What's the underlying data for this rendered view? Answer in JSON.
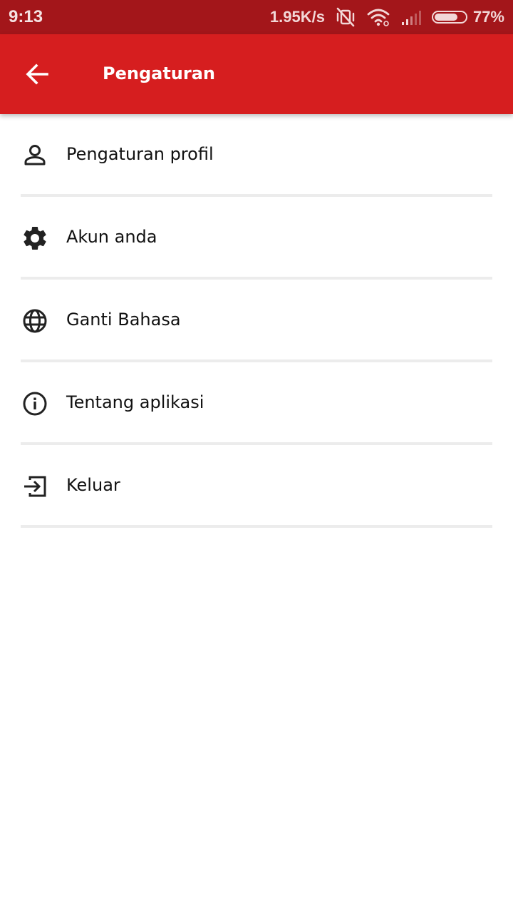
{
  "status_bar": {
    "time": "9:13",
    "net_speed": "1.95K/s",
    "battery_percent": "77%",
    "battery_level": 0.77,
    "icons": [
      "mute-vibrate-off-icon",
      "wifi-icon",
      "cellular-signal-icon",
      "battery-icon"
    ]
  },
  "app_bar": {
    "title": "Pengaturan",
    "back_icon": "arrow-left-icon",
    "background_color": "#d61e1f"
  },
  "menu": {
    "items": [
      {
        "label": "Pengaturan profil",
        "icon": "person-icon"
      },
      {
        "label": "Akun anda",
        "icon": "gear-icon"
      },
      {
        "label": "Ganti Bahasa",
        "icon": "globe-icon"
      },
      {
        "label": "Tentang aplikasi",
        "icon": "info-icon"
      },
      {
        "label": "Keluar",
        "icon": "logout-icon"
      }
    ]
  }
}
